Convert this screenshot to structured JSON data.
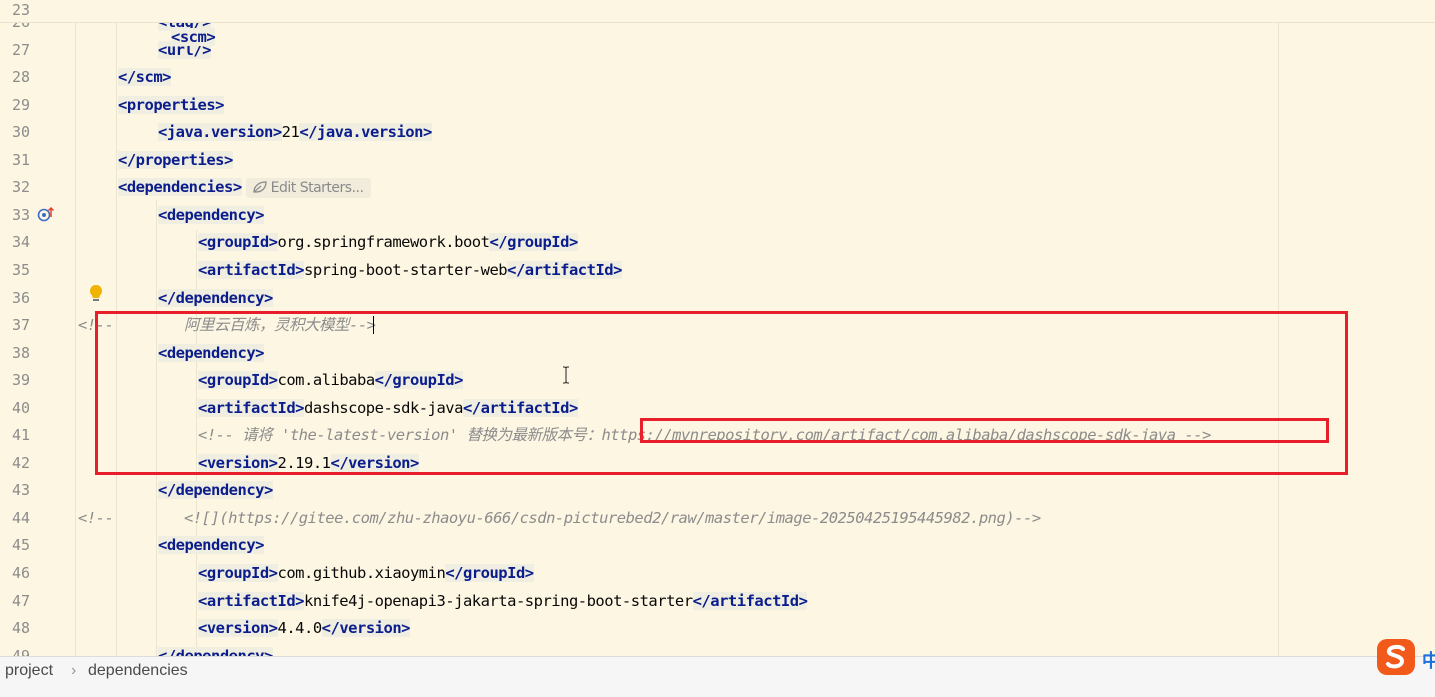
{
  "editor": {
    "sticky_line": {
      "num": "23",
      "text": "<scm>"
    },
    "lines": [
      {
        "num": "26",
        "indent": 2,
        "parts": [
          [
            "t",
            "<tag/>"
          ]
        ]
      },
      {
        "num": "27",
        "indent": 2,
        "parts": [
          [
            "t",
            "<url/>"
          ]
        ]
      },
      {
        "num": "28",
        "indent": 1,
        "parts": [
          [
            "t",
            "</scm>"
          ]
        ]
      },
      {
        "num": "29",
        "indent": 1,
        "parts": [
          [
            "t",
            "<properties>"
          ]
        ]
      },
      {
        "num": "30",
        "indent": 2,
        "parts": [
          [
            "t",
            "<java.version>"
          ],
          [
            "x",
            "21"
          ],
          [
            "t",
            "</java.version>"
          ]
        ]
      },
      {
        "num": "31",
        "indent": 1,
        "parts": [
          [
            "t",
            "</properties>"
          ]
        ]
      },
      {
        "num": "32",
        "indent": 1,
        "parts": [
          [
            "t",
            "<dependencies>"
          ]
        ]
      },
      {
        "num": "33",
        "indent": 2,
        "parts": [
          [
            "t",
            "<dependency>"
          ]
        ]
      },
      {
        "num": "34",
        "indent": 3,
        "parts": [
          [
            "t",
            "<groupId>"
          ],
          [
            "x",
            "org.springframework.boot"
          ],
          [
            "t",
            "</groupId>"
          ]
        ]
      },
      {
        "num": "35",
        "indent": 3,
        "parts": [
          [
            "t",
            "<artifactId>"
          ],
          [
            "x",
            "spring-boot-starter-web"
          ],
          [
            "t",
            "</artifactId>"
          ]
        ]
      },
      {
        "num": "36",
        "indent": 2,
        "parts": [
          [
            "t",
            "</dependency>"
          ]
        ]
      },
      {
        "num": "37",
        "indent": 0,
        "parts": [
          [
            "c",
            "<!--        阿里云百炼，灵积大模型-->"
          ]
        ]
      },
      {
        "num": "38",
        "indent": 2,
        "parts": [
          [
            "t",
            "<dependency>"
          ]
        ]
      },
      {
        "num": "39",
        "indent": 3,
        "parts": [
          [
            "t",
            "<groupId>"
          ],
          [
            "x",
            "com.alibaba"
          ],
          [
            "t",
            "</groupId>"
          ]
        ]
      },
      {
        "num": "40",
        "indent": 3,
        "parts": [
          [
            "t",
            "<artifactId>"
          ],
          [
            "x",
            "dashscope-sdk-java"
          ],
          [
            "t",
            "</artifactId>"
          ]
        ]
      },
      {
        "num": "41",
        "indent": 3,
        "parts": [
          [
            "c",
            "<!-- 请将 'the-latest-version' 替换为最新版本号："
          ],
          [
            "l",
            "https://mvnrepository.com/artifact/com.alibaba/dashscope-sdk-java"
          ],
          [
            "c",
            " -->"
          ]
        ]
      },
      {
        "num": "42",
        "indent": 3,
        "parts": [
          [
            "t",
            "<version>"
          ],
          [
            "x",
            "2.19.1"
          ],
          [
            "t",
            "</version>"
          ]
        ]
      },
      {
        "num": "43",
        "indent": 2,
        "parts": [
          [
            "t",
            "</dependency>"
          ]
        ]
      },
      {
        "num": "44",
        "indent": 0,
        "parts": [
          [
            "c",
            "<!--        <![]("
          ],
          [
            "l",
            "https://gitee.com/zhu-zhaoyu-666/csdn-picturebed2/raw/master/image-20250425195445982.png"
          ],
          [
            "c",
            ")-->"
          ]
        ]
      },
      {
        "num": "45",
        "indent": 2,
        "parts": [
          [
            "t",
            "<dependency>"
          ]
        ]
      },
      {
        "num": "46",
        "indent": 3,
        "parts": [
          [
            "t",
            "<groupId>"
          ],
          [
            "x",
            "com.github.xiaoymin"
          ],
          [
            "t",
            "</groupId>"
          ]
        ]
      },
      {
        "num": "47",
        "indent": 3,
        "parts": [
          [
            "t",
            "<artifactId>"
          ],
          [
            "x",
            "knife4j-openapi3-jakarta-spring-boot-starter"
          ],
          [
            "t",
            "</artifactId>"
          ]
        ]
      },
      {
        "num": "48",
        "indent": 3,
        "parts": [
          [
            "t",
            "<version>"
          ],
          [
            "x",
            "4.4.0"
          ],
          [
            "t",
            "</version>"
          ]
        ]
      },
      {
        "num": "49",
        "indent": 2,
        "parts": [
          [
            "t",
            "</dependency>"
          ]
        ]
      }
    ],
    "hint_label": "Edit Starters...",
    "hint_icon": "spring-leaf-icon",
    "gutter_icons": {
      "line33": "run-override-icon",
      "line36": "lightbulb-icon"
    }
  },
  "breadcrumb": {
    "items": [
      "project",
      "dependencies"
    ],
    "separator": "›"
  },
  "ime": {
    "label": "中"
  },
  "colors": {
    "background": "#fdf6e3",
    "tag": "#0b1d8c",
    "comment": "#8c8c8c",
    "highlight_box": "#e81e2b"
  }
}
